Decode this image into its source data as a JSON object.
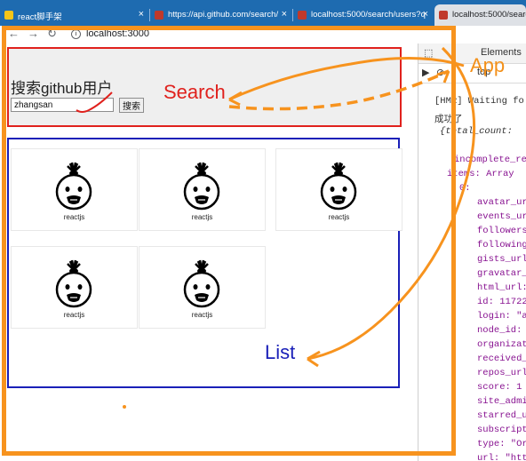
{
  "browser": {
    "tabs": [
      {
        "title": "react脚手架",
        "active": false
      },
      {
        "title": "https://api.github.com/search/",
        "active": false
      },
      {
        "title": "localhost:5000/search/users?q",
        "active": false
      },
      {
        "title": "localhost:5000/search",
        "active": true
      }
    ],
    "url": "localhost:3000"
  },
  "page": {
    "search": {
      "title": "搜索github用户",
      "input_value": "zhangsan",
      "button_label": "搜索"
    },
    "users": [
      {
        "login": "reactjs"
      },
      {
        "login": "reactjs"
      },
      {
        "login": "reactjs"
      },
      {
        "login": "reactjs"
      },
      {
        "login": "reactjs"
      }
    ]
  },
  "devtools": {
    "tab_elements": "Elements",
    "context": "top",
    "lines": [
      {
        "text": "[HMR] Waiting fo",
        "cls": ""
      },
      {
        "text": "成功了",
        "cls": ""
      },
      {
        "text": "{total_count:",
        "cls": ""
      },
      {
        "text": "incomplete_re",
        "cls": "k"
      },
      {
        "text": "items: Array",
        "cls": "k"
      },
      {
        "text": "0:",
        "cls": "k"
      },
      {
        "text": "avatar_ur",
        "cls": "k"
      },
      {
        "text": "events_ur",
        "cls": "k"
      },
      {
        "text": "followers",
        "cls": "k"
      },
      {
        "text": "following",
        "cls": "k"
      },
      {
        "text": "gists_url",
        "cls": "k"
      },
      {
        "text": "gravatar_",
        "cls": "k"
      },
      {
        "text": "html_url:",
        "cls": "k"
      },
      {
        "text": "id: 11722",
        "cls": "k"
      },
      {
        "text": "login: \"a",
        "cls": "k"
      },
      {
        "text": "node_id:",
        "cls": "k"
      },
      {
        "text": "organizat",
        "cls": "k"
      },
      {
        "text": "received_",
        "cls": "k"
      },
      {
        "text": "repos_url",
        "cls": "k"
      },
      {
        "text": "score: 1",
        "cls": "k"
      },
      {
        "text": "site_admi",
        "cls": "k"
      },
      {
        "text": "starred_u",
        "cls": "k"
      },
      {
        "text": "subscript",
        "cls": "k"
      },
      {
        "text": "type: \"Or",
        "cls": "k"
      },
      {
        "text": "url: \"htt",
        "cls": "k"
      }
    ]
  },
  "annotations": {
    "search": "Search",
    "app": "App",
    "list": "List"
  }
}
